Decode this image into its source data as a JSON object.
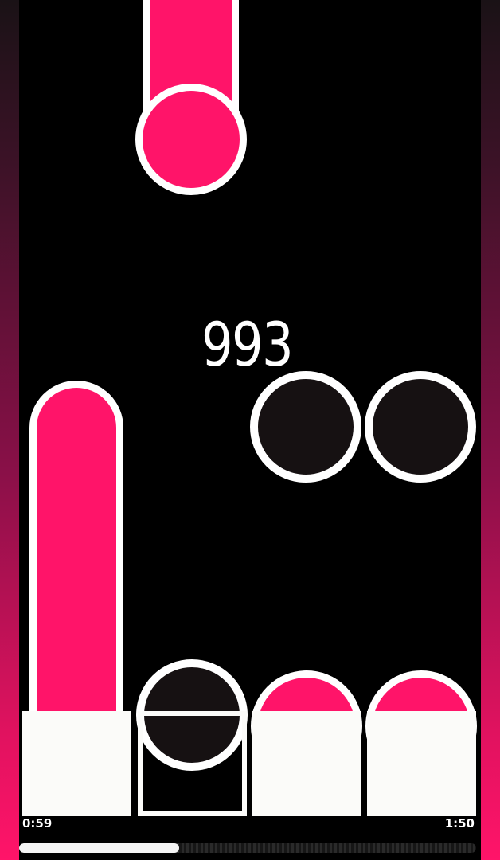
{
  "game": {
    "score": "993",
    "time_elapsed": "0:59",
    "time_total": "1:50",
    "progress_fraction": 0.35
  },
  "colors": {
    "note_pink": "#ff1469",
    "note_dark": "#161112",
    "outline": "#ffffff",
    "pad_white": "#fbfbf9",
    "background": "#000000"
  },
  "lanes": {
    "count": 4,
    "pressed_lane": 2
  },
  "icons": [
    "hold-note",
    "tap-note",
    "receptor-pad"
  ]
}
